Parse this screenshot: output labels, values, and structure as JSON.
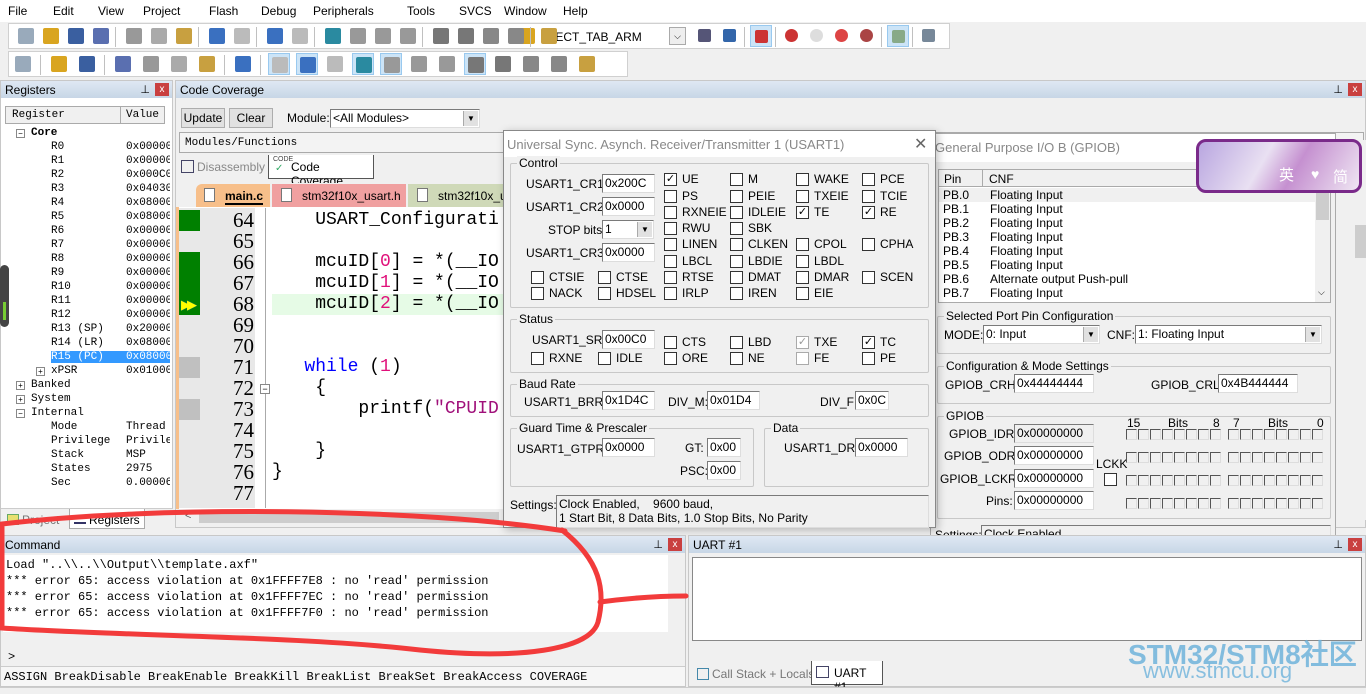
{
  "menu": [
    "File",
    "Edit",
    "View",
    "Project",
    "Flash",
    "Debug",
    "Peripherals",
    "Tools",
    "SVCS",
    "Window",
    "Help"
  ],
  "toolbar1": {
    "icons": [
      "new-file-icon",
      "open-file-icon",
      "save-icon",
      "save-all-icon",
      "cut-icon",
      "copy-icon",
      "paste-icon",
      "undo-icon",
      "redo-icon",
      "navigate-back-icon",
      "navigate-forward-icon",
      "bookmark-icon",
      "prev-bookmark-icon",
      "next-bookmark-icon",
      "clear-bookmarks-icon",
      "indent-icon",
      "unindent-icon",
      "comment-icon",
      "uncomment-icon",
      "find-in-files-icon"
    ],
    "target": "WECT_TAB_ARM",
    "icons_right": [
      "find-icon",
      "incremental-find-icon",
      "debug-session-icon",
      "breakpoint-icon",
      "disable-breakpoint-icon",
      "disable-all-breakpoints-icon",
      "kill-breakpoints-icon",
      "window-layout-icon",
      "configure-icon"
    ]
  },
  "toolbar2": {
    "icons": [
      "reset-icon",
      "run-icon",
      "stop-icon",
      "step-into-icon",
      "step-over-icon",
      "step-out-icon",
      "run-to-cursor-icon",
      "show-next-statement-icon",
      "command-window-icon",
      "disassembly-window-icon",
      "symbols-window-icon",
      "registers-window-icon",
      "call-stack-icon",
      "watch-windows-icon",
      "memory-windows-icon",
      "serial-windows-icon",
      "analysis-windows-icon",
      "trace-windows-icon",
      "system-viewer-icon",
      "toolbox-icon"
    ]
  },
  "registers": {
    "title": "Registers",
    "col_register": "Register",
    "col_value": "Value",
    "core_label": "Core",
    "core": [
      {
        "name": "R0",
        "value": "0x00000"
      },
      {
        "name": "R1",
        "value": "0x00000"
      },
      {
        "name": "R2",
        "value": "0x000C0"
      },
      {
        "name": "R3",
        "value": "0x04030"
      },
      {
        "name": "R4",
        "value": "0x08000"
      },
      {
        "name": "R5",
        "value": "0x08000"
      },
      {
        "name": "R6",
        "value": "0x00000"
      },
      {
        "name": "R7",
        "value": "0x00000"
      },
      {
        "name": "R8",
        "value": "0x00000"
      },
      {
        "name": "R9",
        "value": "0x00000"
      },
      {
        "name": "R10",
        "value": "0x00000"
      },
      {
        "name": "R11",
        "value": "0x00000"
      },
      {
        "name": "R12",
        "value": "0x00000"
      },
      {
        "name": "R13 (SP)",
        "value": "0x20000"
      },
      {
        "name": "R14 (LR)",
        "value": "0x08000"
      },
      {
        "name": "R15 (PC)",
        "value": "0x08000"
      },
      {
        "name": "xPSR",
        "value": "0x01000"
      }
    ],
    "groups": [
      "Banked",
      "System",
      "Internal"
    ],
    "internal": [
      {
        "name": "Mode",
        "value": "Thread"
      },
      {
        "name": "Privilege",
        "value": "Privile"
      },
      {
        "name": "Stack",
        "value": "MSP"
      },
      {
        "name": "States",
        "value": "2975"
      },
      {
        "name": "Sec",
        "value": "0.00006"
      }
    ],
    "tabs": [
      "Project",
      "Registers"
    ]
  },
  "coverage": {
    "title": "Code Coverage",
    "update": "Update",
    "clear": "Clear",
    "module_label": "Module:",
    "module_value": "<All Modules>",
    "column": "Modules/Functions",
    "tabs": [
      "Disassembly",
      "Code Coverage"
    ],
    "code_badge": "CODE"
  },
  "editor": {
    "files": [
      "main.c",
      "stm32f10x_usart.h",
      "stm32f10x_us"
    ],
    "lines": [
      {
        "n": "64",
        "cov": "green",
        "tokens": [
          [
            "    USART_Configurati",
            "p"
          ]
        ]
      },
      {
        "n": "65",
        "cov": "",
        "tokens": []
      },
      {
        "n": "66",
        "cov": "green",
        "tokens": [
          [
            "    mcuID[",
            "p"
          ],
          [
            "0",
            "n"
          ],
          [
            "] = *(__IO",
            "p"
          ]
        ]
      },
      {
        "n": "67",
        "cov": "green",
        "tokens": [
          [
            "    mcuID[",
            "p"
          ],
          [
            "1",
            "n"
          ],
          [
            "] = *(__IO",
            "p"
          ]
        ]
      },
      {
        "n": "68",
        "cov": "green",
        "current": true,
        "tokens": [
          [
            "    mcuID[",
            "p"
          ],
          [
            "2",
            "n"
          ],
          [
            "] = *(__IO",
            "p"
          ]
        ]
      },
      {
        "n": "69",
        "cov": "",
        "tokens": []
      },
      {
        "n": "70",
        "cov": "",
        "tokens": []
      },
      {
        "n": "71",
        "cov": "gray",
        "tokens": [
          [
            "   ",
            "p"
          ],
          [
            "while",
            "k"
          ],
          [
            " (",
            "p"
          ],
          [
            "1",
            "n"
          ],
          [
            ")",
            "p"
          ]
        ]
      },
      {
        "n": "72",
        "cov": "",
        "tokens": [
          [
            "    {",
            "p"
          ]
        ]
      },
      {
        "n": "73",
        "cov": "gray",
        "tokens": [
          [
            "        printf(",
            "p"
          ],
          [
            "\"CPUID",
            "s"
          ]
        ]
      },
      {
        "n": "74",
        "cov": "",
        "tokens": []
      },
      {
        "n": "75",
        "cov": "",
        "tokens": [
          [
            "    }",
            "p"
          ]
        ]
      },
      {
        "n": "76",
        "cov": "",
        "tokens": [
          [
            "}",
            "p"
          ]
        ]
      },
      {
        "n": "77",
        "cov": "",
        "tokens": []
      }
    ]
  },
  "usart": {
    "title": "Universal Sync. Asynch. Receiver/Transmitter 1 (USART1)",
    "control": {
      "label": "Control",
      "cr1_label": "USART1_CR1:",
      "cr1": "0x200C",
      "cr2_label": "USART1_CR2:",
      "cr2": "0x0000",
      "stop_label": "STOP bits:",
      "stop": "1",
      "cr3_label": "USART1_CR3:",
      "cr3": "0x0000",
      "grid": [
        [
          {
            "l": "UE",
            "c": true
          },
          {
            "l": "M",
            "c": false
          },
          {
            "l": "WAKE",
            "c": false
          },
          {
            "l": "PCE",
            "c": false
          }
        ],
        [
          {
            "l": "PS",
            "c": false
          },
          {
            "l": "PEIE",
            "c": false
          },
          {
            "l": "TXEIE",
            "c": false
          },
          {
            "l": "TCIE",
            "c": false
          }
        ],
        [
          {
            "l": "RXNEIE",
            "c": false
          },
          {
            "l": "IDLEIE",
            "c": false
          },
          {
            "l": "TE",
            "c": true
          },
          {
            "l": "RE",
            "c": true
          }
        ],
        [
          {
            "l": "RWU",
            "c": false
          },
          {
            "l": "SBK",
            "c": false
          },
          null,
          null
        ],
        [
          {
            "l": "LINEN",
            "c": false
          },
          {
            "l": "CLKEN",
            "c": false
          },
          {
            "l": "CPOL",
            "c": false
          },
          {
            "l": "CPHA",
            "c": false
          }
        ],
        [
          {
            "l": "LBCL",
            "c": false
          },
          {
            "l": "LBDIE",
            "c": false
          },
          {
            "l": "LBDL",
            "c": false
          },
          null
        ],
        [
          {
            "l": "CTSIE",
            "c": false
          },
          {
            "l": "CTSE",
            "c": false
          },
          {
            "l": "RTSE",
            "c": false
          },
          {
            "l": "DMAT",
            "c": false
          },
          {
            "l": "DMAR",
            "c": false
          },
          {
            "l": "SCEN",
            "c": false
          }
        ],
        [
          {
            "l": "NACK",
            "c": false
          },
          {
            "l": "HDSEL",
            "c": false
          },
          {
            "l": "IRLP",
            "c": false
          },
          {
            "l": "IREN",
            "c": false
          },
          {
            "l": "EIE",
            "c": false
          },
          null
        ]
      ]
    },
    "status": {
      "label": "Status",
      "sr_label": "USART1_SR:",
      "sr": "0x00C0",
      "row1": [
        {
          "l": "CTS",
          "c": false
        },
        {
          "l": "LBD",
          "c": false
        },
        {
          "l": "TXE",
          "c": true,
          "dis": true
        },
        {
          "l": "TC",
          "c": true
        }
      ],
      "row2": [
        {
          "l": "RXNE",
          "c": false
        },
        {
          "l": "IDLE",
          "c": false
        },
        {
          "l": "ORE",
          "c": false
        },
        {
          "l": "NE",
          "c": false
        },
        {
          "l": "FE",
          "c": false,
          "dis": true
        },
        {
          "l": "PE",
          "c": false
        }
      ]
    },
    "baud": {
      "label": "Baud Rate",
      "brr_label": "USART1_BRR:",
      "brr": "0x1D4C",
      "divm_label": "DIV_M:",
      "divm": "0x01D4",
      "divf_label": "DIV_F:",
      "divf": "0x0C"
    },
    "guard": {
      "label": "Guard Time & Prescaler",
      "gtpr_label": "USART1_GTPR:",
      "gtpr": "0x0000",
      "gt_label": "GT:",
      "gt": "0x00",
      "psc_label": "PSC:",
      "psc": "0x00"
    },
    "data": {
      "label": "Data",
      "dr_label": "USART1_DR:",
      "dr": "0x0000"
    },
    "settings_label": "Settings:",
    "settings_line1": "Clock Enabled,    9600 baud,",
    "settings_line2": "1 Start Bit, 8 Data Bits, 1.0 Stop Bits, No Parity"
  },
  "gpiob": {
    "title": "General Purpose I/O B (GPIOB)",
    "col_pin": "Pin",
    "col_cnf": "CNF",
    "pins": [
      {
        "pin": "PB.0",
        "cnf": "Floating Input"
      },
      {
        "pin": "PB.1",
        "cnf": "Floating Input"
      },
      {
        "pin": "PB.2",
        "cnf": "Floating Input"
      },
      {
        "pin": "PB.3",
        "cnf": "Floating Input"
      },
      {
        "pin": "PB.4",
        "cnf": "Floating Input"
      },
      {
        "pin": "PB.5",
        "cnf": "Floating Input"
      },
      {
        "pin": "PB.6",
        "cnf": "Alternate output Push-pull"
      },
      {
        "pin": "PB.7",
        "cnf": "Floating Input"
      }
    ],
    "sel_label": "Selected Port Pin Configuration",
    "mode_label": "MODE:",
    "mode": "0: Input",
    "cnf_label": "CNF:",
    "cnf": "1: Floating Input",
    "cfg_label": "Configuration & Mode Settings",
    "crh_label": "GPIOB_CRH:",
    "crh": "0x44444444",
    "crl_label": "GPIOB_CRL:",
    "crl": "0x4B444444",
    "grp_label": "GPIOB",
    "idr_label": "GPIOB_IDR:",
    "idr": "0x00000000",
    "odr_label": "GPIOB_ODR:",
    "odr": "0x00000000",
    "lckr_label": "GPIOB_LCKR:",
    "lckr": "0x00000000",
    "pins_label": "Pins:",
    "pins_val": "0x00000000",
    "lckk": "LCKK",
    "bits_hi": {
      "a": "15",
      "b": "Bits",
      "c": "8"
    },
    "bits_lo": {
      "a": "7",
      "b": "Bits",
      "c": "0"
    },
    "settings_label": "Settings:",
    "settings": "Clock Enabled"
  },
  "ime": {
    "left": "英",
    "right": "简"
  },
  "command": {
    "title": "Command",
    "lines": [
      "Load \"..\\\\..\\\\Output\\\\template.axf\"",
      "*** error 65: access violation at 0x1FFFF7E8 : no 'read' permission",
      "*** error 65: access violation at 0x1FFFF7EC : no 'read' permission",
      "*** error 65: access violation at 0x1FFFF7F0 : no 'read' permission"
    ],
    "prompt": ">",
    "hints": "ASSIGN BreakDisable BreakEnable BreakKill BreakList BreakSet BreakAccess COVERAGE"
  },
  "uart": {
    "title": "UART #1",
    "tabs": [
      "Call Stack + Locals",
      "UART #1"
    ]
  },
  "watermark": {
    "line1": "STM32/STM8社区",
    "line2": "www.stmcu.org"
  },
  "colors": {
    "annotation": "#f23b3b",
    "coverage_full": "#008000",
    "coverage_none": "#c0c0c0",
    "selection": "#3399ff",
    "current_line": "#e6fbe6"
  }
}
